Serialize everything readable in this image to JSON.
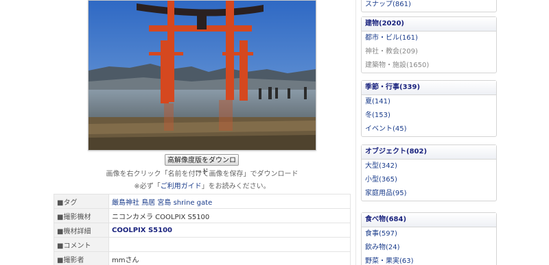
{
  "photo": {
    "alt": "厳島神社 鳥居"
  },
  "download_button": "高解像度版をダウンロード",
  "note_line1": "画像を右クリック「名前を付けて画像を保存」でダウンロード",
  "note_line2_prefix": "※必ず「",
  "note_line2_link": "ご利用ガイド",
  "note_line2_suffix": "」をお読みください。",
  "info": {
    "tag_label": "■タグ",
    "tags": [
      "厳島神社",
      "鳥居",
      "宮島",
      "shrine gate"
    ],
    "camera_label": "■撮影機材",
    "camera_value": "ニコンカメラ COOLPIX S5100",
    "model_label": "■機材詳細",
    "model_value": "COOLPIX S5100",
    "comment_label": "■コメント",
    "comment_value": "",
    "photographer_label": "■撮影者",
    "photographer_value": "mmさん"
  },
  "sidebar": {
    "top_item": "スナップ(861)",
    "categories": [
      {
        "title": "建物(2020)",
        "items": [
          {
            "label": "都市・ビル(161)",
            "dim": false
          },
          {
            "label": "神社・教会(209)",
            "dim": true
          },
          {
            "label": "建築物・施設(1650)",
            "dim": true
          }
        ]
      },
      {
        "title": "季節・行事(339)",
        "items": [
          {
            "label": "夏(141)",
            "dim": false
          },
          {
            "label": "冬(153)",
            "dim": false
          },
          {
            "label": "イベント(45)",
            "dim": false
          }
        ]
      },
      {
        "title": "オブジェクト(802)",
        "items": [
          {
            "label": "大型(342)",
            "dim": false
          },
          {
            "label": "小型(365)",
            "dim": false
          },
          {
            "label": "家庭用品(95)",
            "dim": false
          }
        ]
      },
      {
        "title": "食べ物(684)",
        "items": [
          {
            "label": "食事(597)",
            "dim": false
          },
          {
            "label": "飲み物(24)",
            "dim": false
          },
          {
            "label": "野菜・果実(63)",
            "dim": false
          }
        ]
      }
    ]
  },
  "colors": {
    "link": "#1a3c8b",
    "heading": "#1a237e",
    "torii": "#d5481f"
  }
}
